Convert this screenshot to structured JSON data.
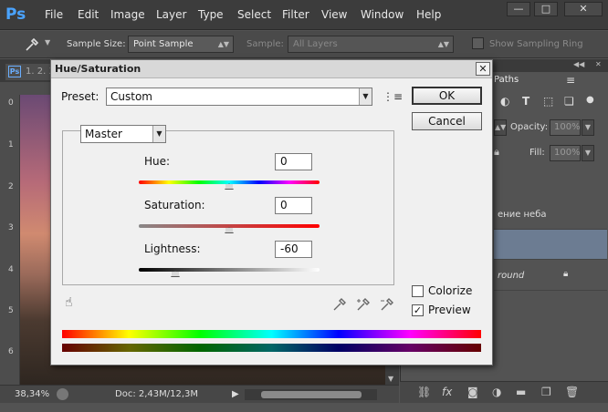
{
  "menubar": {
    "logo": "Ps",
    "items": [
      "File",
      "Edit",
      "Image",
      "Layer",
      "Type",
      "Select",
      "Filter",
      "View",
      "Window",
      "Help"
    ],
    "win_min": "—",
    "win_max": "□",
    "win_close": "✕"
  },
  "options": {
    "sample_size_label": "Sample Size:",
    "sample_size_value": "Point Sample",
    "sample_label": "Sample:",
    "sample_value": "All Layers",
    "show_ring_label": "Show Sampling Ring"
  },
  "document": {
    "tab_label": "1. 2. 3",
    "zoom": "38,34%",
    "doc_info": "Doc: 2,43M/12,3M",
    "ruler_marks": [
      "0",
      "1",
      "2",
      "3",
      "4",
      "5",
      "6"
    ]
  },
  "right_panel": {
    "paths_tab": "Paths",
    "opacity_label": "Opacity:",
    "opacity_value": "100%",
    "fill_label": "Fill:",
    "fill_value": "100%",
    "layers": [
      {
        "name": "ение неба"
      },
      {
        "name": ""
      },
      {
        "name": "round"
      }
    ]
  },
  "dialog": {
    "title": "Hue/Saturation",
    "preset_label": "Preset:",
    "preset_value": "Custom",
    "ok": "OK",
    "cancel": "Cancel",
    "channel": "Master",
    "hue_label": "Hue:",
    "hue_value": "0",
    "saturation_label": "Saturation:",
    "saturation_value": "0",
    "lightness_label": "Lightness:",
    "lightness_value": "-60",
    "colorize_label": "Colorize",
    "colorize_checked": false,
    "preview_label": "Preview",
    "preview_checked": true,
    "preview_check_glyph": "✓"
  },
  "colors": {
    "dialog_bg": "#f0f0f0",
    "ps_blue": "#4aa3ff",
    "selected_layer": "#6c7c92"
  }
}
